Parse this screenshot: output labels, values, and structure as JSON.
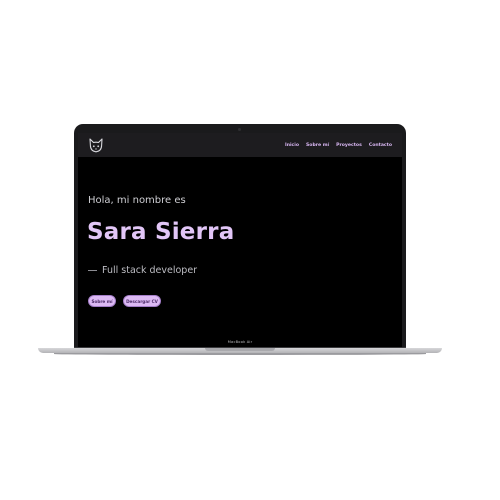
{
  "nav": {
    "logo_icon": "cat-head-icon",
    "links": [
      "Inicio",
      "Sobre mí",
      "Proyectos",
      "Contacto"
    ]
  },
  "hero": {
    "greeting": "Hola, mi nombre es",
    "name": "Sara Sierra",
    "role": "Full stack developer",
    "button_about": "Sobre mí",
    "button_cv": "Descargar CV"
  },
  "device": {
    "model_label": "MacBook Air"
  },
  "colors": {
    "accent": "#dcb9f4",
    "name_text": "#e2c6f7",
    "screen_bg": "#000000",
    "navbar_bg": "#1d1c1f"
  }
}
